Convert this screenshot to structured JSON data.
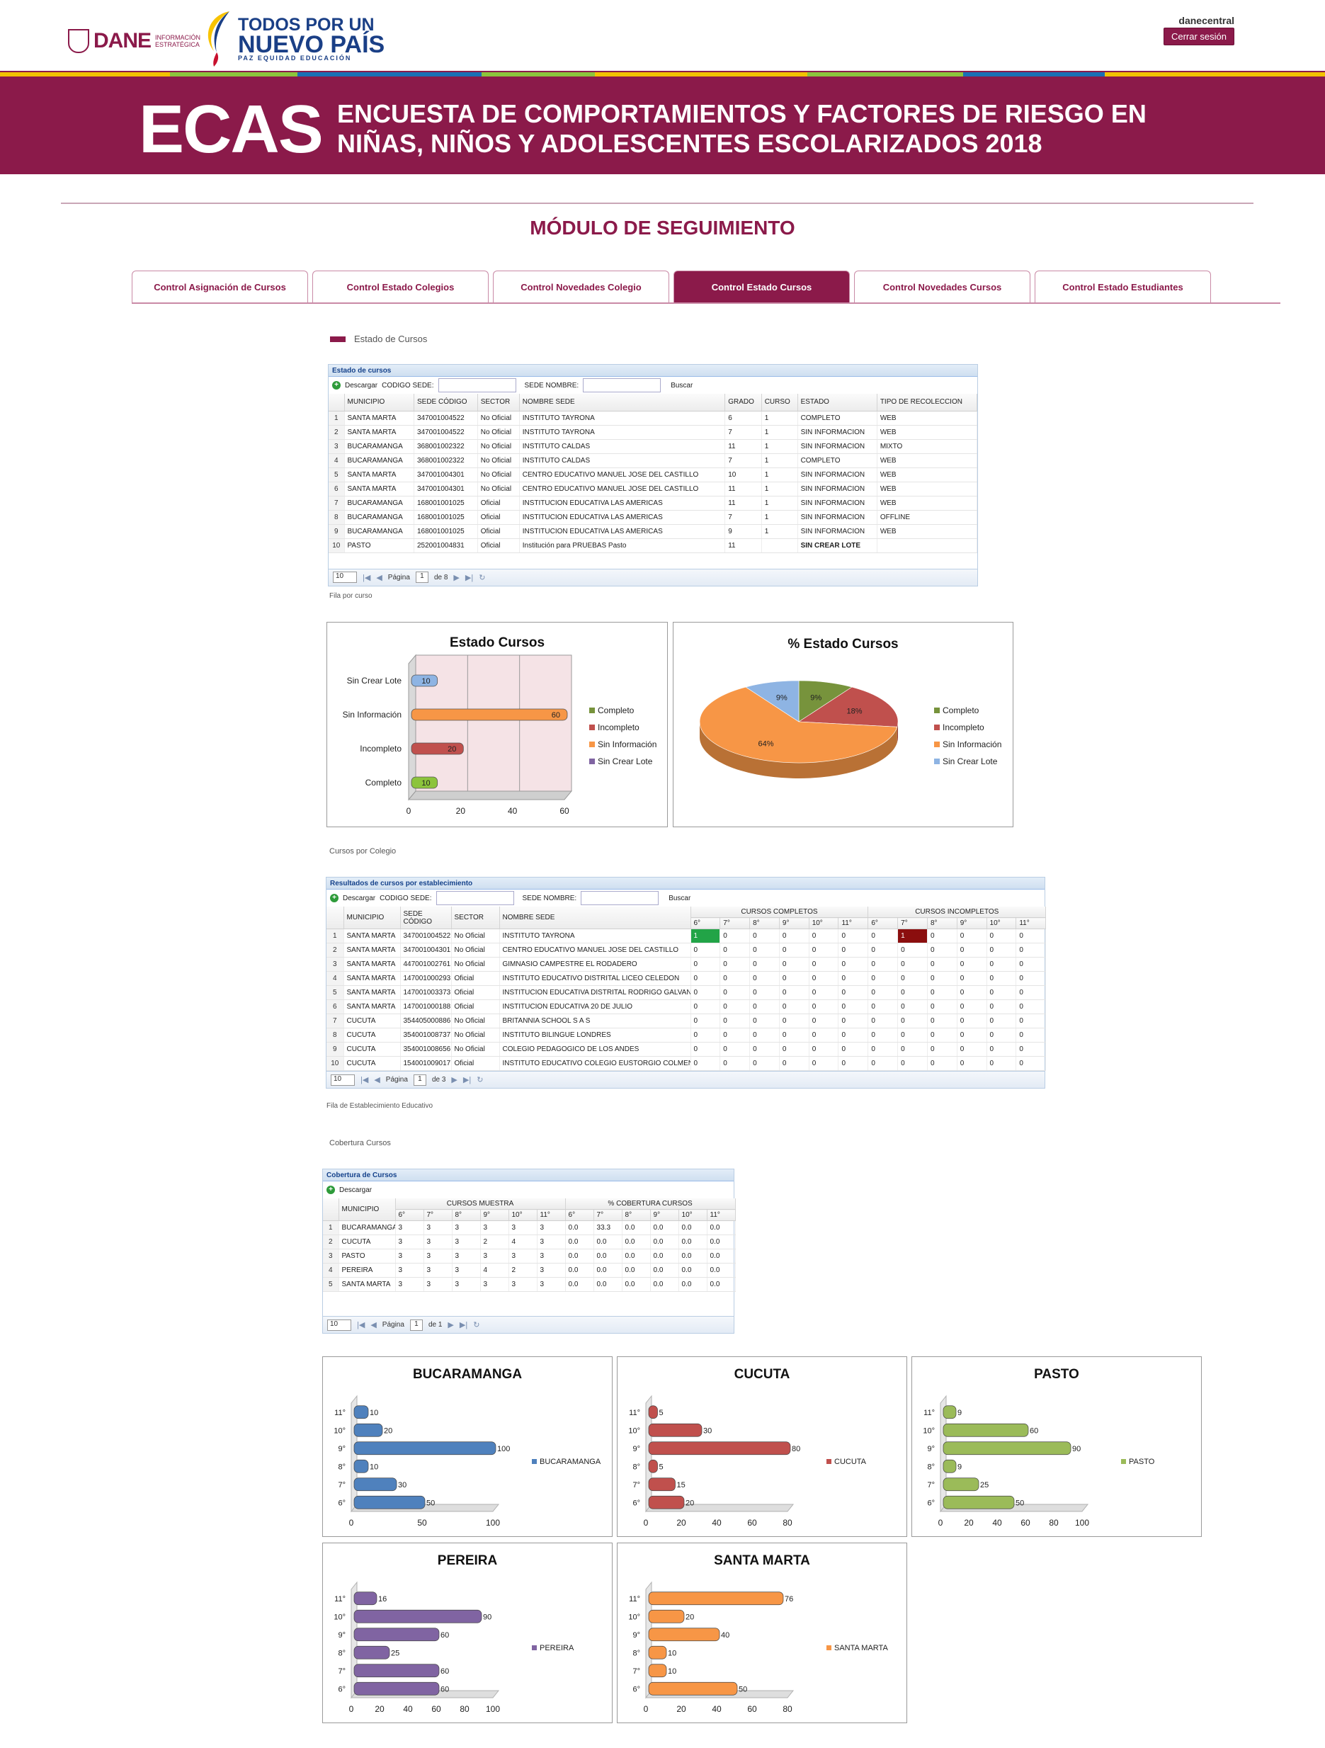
{
  "header": {
    "dane_logo": "DANE",
    "dane_subtitle": "INFORMACIÓN ESTRATÉGICA",
    "gov_logo_line1": "TODOS POR UN",
    "gov_logo_line2": "NUEVO PAÍS",
    "gov_logo_line3": "PAZ  EQUIDAD  EDUCACIÓN",
    "user": "danecentral",
    "logout_label": "Cerrar sesión"
  },
  "banner": {
    "acronym": "ECAS",
    "line1": "ENCUESTA DE COMPORTAMIENTOS Y FACTORES DE RIESGO EN",
    "line2": "NIÑAS, NIÑOS Y ADOLESCENTES ESCOLARIZADOS 2018",
    "color": "#8b1a4a"
  },
  "module_title": "MÓDULO DE SEGUIMIENTO",
  "tabs": [
    {
      "label": "Control Asignación de Cursos"
    },
    {
      "label": "Control Estado Colegios"
    },
    {
      "label": "Control Novedades Colegio"
    },
    {
      "label": "Control Estado Cursos",
      "active": true
    },
    {
      "label": "Control Novedades Cursos"
    },
    {
      "label": "Control Estado Estudiantes"
    }
  ],
  "section_label": "Estado de Cursos",
  "estado_grid": {
    "title": "Estado de cursos",
    "download": "Descargar",
    "codigo_label": "CODIGO SEDE:",
    "nombre_label": "SEDE NOMBRE:",
    "search": "Buscar",
    "columns": [
      "MUNICIPIO",
      "SEDE CÓDIGO",
      "SECTOR",
      "NOMBRE SEDE",
      "GRADO",
      "CURSO",
      "ESTADO",
      "TIPO DE RECOLECCION"
    ],
    "rows": [
      [
        "1",
        "SANTA MARTA",
        "347001004522",
        "No Oficial",
        "INSTITUTO TAYRONA",
        "6",
        "1",
        "COMPLETO",
        "WEB"
      ],
      [
        "2",
        "SANTA MARTA",
        "347001004522",
        "No Oficial",
        "INSTITUTO TAYRONA",
        "7",
        "1",
        "SIN INFORMACION",
        "WEB"
      ],
      [
        "3",
        "BUCARAMANGA",
        "368001002322",
        "No Oficial",
        "INSTITUTO CALDAS",
        "11",
        "1",
        "SIN INFORMACION",
        "MIXTO"
      ],
      [
        "4",
        "BUCARAMANGA",
        "368001002322",
        "No Oficial",
        "INSTITUTO CALDAS",
        "7",
        "1",
        "COMPLETO",
        "WEB"
      ],
      [
        "5",
        "SANTA MARTA",
        "347001004301",
        "No Oficial",
        "CENTRO EDUCATIVO MANUEL JOSE DEL CASTILLO",
        "10",
        "1",
        "SIN INFORMACION",
        "WEB"
      ],
      [
        "6",
        "SANTA MARTA",
        "347001004301",
        "No Oficial",
        "CENTRO EDUCATIVO MANUEL JOSE DEL CASTILLO",
        "11",
        "1",
        "SIN INFORMACION",
        "WEB"
      ],
      [
        "7",
        "BUCARAMANGA",
        "168001001025",
        "Oficial",
        "INSTITUCION EDUCATIVA LAS AMERICAS",
        "11",
        "1",
        "SIN INFORMACION",
        "WEB"
      ],
      [
        "8",
        "BUCARAMANGA",
        "168001001025",
        "Oficial",
        "INSTITUCION EDUCATIVA LAS AMERICAS",
        "7",
        "1",
        "SIN INFORMACION",
        "OFFLINE"
      ],
      [
        "9",
        "BUCARAMANGA",
        "168001001025",
        "Oficial",
        "INSTITUCION EDUCATIVA LAS AMERICAS",
        "9",
        "1",
        "SIN INFORMACION",
        "WEB"
      ],
      [
        "10",
        "PASTO",
        "252001004831",
        "Oficial",
        "Institución para PRUEBAS Pasto",
        "11",
        "",
        "SIN CREAR LOTE",
        ""
      ]
    ],
    "page_size": "10",
    "page_label": "Página",
    "page": "1",
    "page_of": "de 8",
    "footnote": "Fila por curso"
  },
  "estado_chart": {
    "chart_data": {
      "type": "bar",
      "title": "Estado Cursos",
      "categories": [
        "Completo",
        "Incompleto",
        "Sin Información",
        "Sin Crear Lote"
      ],
      "values": [
        10,
        20,
        60,
        10
      ],
      "colors": [
        "#8cc43c",
        "#c0504d",
        "#f79646",
        "#8eb4e3"
      ],
      "xlim": [
        0,
        60
      ],
      "ticks": [
        "0",
        "20",
        "40",
        "60"
      ],
      "legend": [
        "Completo",
        "Incompleto",
        "Sin Información",
        "Sin Crear Lote"
      ],
      "legend_colors": [
        "#77933c",
        "#c0504d",
        "#f79646",
        "#8064a2"
      ]
    }
  },
  "pie_chart": {
    "chart_data": {
      "type": "pie",
      "title": "% Estado Cursos",
      "labels": [
        "Completo",
        "Incompleto",
        "Sin Información",
        "Sin Crear Lote"
      ],
      "values": [
        9,
        18,
        64,
        9
      ],
      "value_labels": [
        "9%",
        "18%",
        "64%",
        "9%"
      ],
      "colors": [
        "#77933c",
        "#c0504d",
        "#f79646",
        "#8eb4e3"
      ]
    }
  },
  "colegio_label": "Cursos por Colegio",
  "colegio_grid": {
    "title": "Resultados de cursos por establecimiento",
    "download": "Descargar",
    "codigo_label": "CODIGO SEDE:",
    "nombre_label": "SEDE NOMBRE:",
    "search": "Buscar",
    "group_completos": "CURSOS COMPLETOS",
    "group_incompletos": "CURSOS INCOMPLETOS",
    "columns": [
      "MUNICIPIO",
      "SEDE CÓDIGO",
      "SECTOR",
      "NOMBRE SEDE"
    ],
    "grades": [
      "6°",
      "7°",
      "8°",
      "9°",
      "10°",
      "11°"
    ],
    "rows": [
      [
        "1",
        "SANTA MARTA",
        "347001004522",
        "No Oficial",
        "INSTITUTO TAYRONA",
        "1",
        "0",
        "0",
        "0",
        "0",
        "0",
        "0",
        "1",
        "0",
        "0",
        "0",
        "0"
      ],
      [
        "2",
        "SANTA MARTA",
        "347001004301",
        "No Oficial",
        "CENTRO EDUCATIVO MANUEL JOSE DEL CASTILLO",
        "0",
        "0",
        "0",
        "0",
        "0",
        "0",
        "0",
        "0",
        "0",
        "0",
        "0",
        "0"
      ],
      [
        "3",
        "SANTA MARTA",
        "447001002761",
        "No Oficial",
        "GIMNASIO CAMPESTRE EL RODADERO",
        "0",
        "0",
        "0",
        "0",
        "0",
        "0",
        "0",
        "0",
        "0",
        "0",
        "0",
        "0"
      ],
      [
        "4",
        "SANTA MARTA",
        "147001000293",
        "Oficial",
        "INSTITUTO EDUCATIVO DISTRITAL LICEO CELEDON",
        "0",
        "0",
        "0",
        "0",
        "0",
        "0",
        "0",
        "0",
        "0",
        "0",
        "0",
        "0"
      ],
      [
        "5",
        "SANTA MARTA",
        "147001003373",
        "Oficial",
        "INSTITUCION EDUCATIVA DISTRITAL RODRIGO GALVAN DE LA",
        "0",
        "0",
        "0",
        "0",
        "0",
        "0",
        "0",
        "0",
        "0",
        "0",
        "0",
        "0"
      ],
      [
        "6",
        "SANTA MARTA",
        "147001000188",
        "Oficial",
        "INSTITUCION EDUCATIVA 20 DE JULIO",
        "0",
        "0",
        "0",
        "0",
        "0",
        "0",
        "0",
        "0",
        "0",
        "0",
        "0",
        "0"
      ],
      [
        "7",
        "CUCUTA",
        "354405000886",
        "No Oficial",
        "BRITANNIA SCHOOL S A S",
        "0",
        "0",
        "0",
        "0",
        "0",
        "0",
        "0",
        "0",
        "0",
        "0",
        "0",
        "0"
      ],
      [
        "8",
        "CUCUTA",
        "354001008737",
        "No Oficial",
        "INSTITUTO BILINGUE LONDRES",
        "0",
        "0",
        "0",
        "0",
        "0",
        "0",
        "0",
        "0",
        "0",
        "0",
        "0",
        "0"
      ],
      [
        "9",
        "CUCUTA",
        "354001008656",
        "No Oficial",
        "COLEGIO PEDAGOGICO DE LOS ANDES",
        "0",
        "0",
        "0",
        "0",
        "0",
        "0",
        "0",
        "0",
        "0",
        "0",
        "0",
        "0"
      ],
      [
        "10",
        "CUCUTA",
        "154001009017",
        "Oficial",
        "INSTITUTO EDUCATIVO COLEGIO EUSTORGIO COLMENARES B",
        "0",
        "0",
        "0",
        "0",
        "0",
        "0",
        "0",
        "0",
        "0",
        "0",
        "0",
        "0"
      ]
    ],
    "page_size": "10",
    "page_label": "Página",
    "page": "1",
    "page_of": "de 3",
    "footnote": "Fila de Establecimiento Educativo"
  },
  "cobertura_label": "Cobertura Cursos",
  "cobertura_grid": {
    "title": "Cobertura de Cursos",
    "download": "Descargar",
    "municipio": "MUNICIPIO",
    "group_muestra": "CURSOS MUESTRA",
    "group_cobertura": "% COBERTURA CURSOS",
    "grades": [
      "6°",
      "7°",
      "8°",
      "9°",
      "10°",
      "11°"
    ],
    "rows": [
      [
        "1",
        "BUCARAMANGA",
        "3",
        "3",
        "3",
        "3",
        "3",
        "3",
        "0.0",
        "33.3",
        "0.0",
        "0.0",
        "0.0",
        "0.0"
      ],
      [
        "2",
        "CUCUTA",
        "3",
        "3",
        "3",
        "2",
        "4",
        "3",
        "0.0",
        "0.0",
        "0.0",
        "0.0",
        "0.0",
        "0.0"
      ],
      [
        "3",
        "PASTO",
        "3",
        "3",
        "3",
        "3",
        "3",
        "3",
        "0.0",
        "0.0",
        "0.0",
        "0.0",
        "0.0",
        "0.0"
      ],
      [
        "4",
        "PEREIRA",
        "3",
        "3",
        "3",
        "4",
        "2",
        "3",
        "0.0",
        "0.0",
        "0.0",
        "0.0",
        "0.0",
        "0.0"
      ],
      [
        "5",
        "SANTA MARTA",
        "3",
        "3",
        "3",
        "3",
        "3",
        "3",
        "0.0",
        "0.0",
        "0.0",
        "0.0",
        "0.0",
        "0.0"
      ]
    ],
    "page_size": "10",
    "page_label": "Página",
    "page": "1",
    "page_of": "de 1"
  },
  "city_charts": {
    "chart_data": [
      {
        "type": "bar",
        "title": "BUCARAMANGA",
        "categories": [
          "6°",
          "7°",
          "8°",
          "9°",
          "10°",
          "11°"
        ],
        "values": [
          50,
          30,
          10,
          100,
          20,
          10
        ],
        "xlim": [
          0,
          100
        ],
        "ticks": [
          "0",
          "50",
          "100"
        ],
        "legend": "BUCARAMANGA",
        "color": "#4f81bd"
      },
      {
        "type": "bar",
        "title": "CUCUTA",
        "categories": [
          "6°",
          "7°",
          "8°",
          "9°",
          "10°",
          "11°"
        ],
        "values": [
          20,
          15,
          5,
          80,
          30,
          5
        ],
        "xlim": [
          0,
          80
        ],
        "ticks": [
          "0",
          "20",
          "40",
          "60",
          "80"
        ],
        "legend": "CUCUTA",
        "color": "#c0504d"
      },
      {
        "type": "bar",
        "title": "PASTO",
        "categories": [
          "6°",
          "7°",
          "8°",
          "9°",
          "10°",
          "11°"
        ],
        "values": [
          50,
          25,
          9,
          90,
          60,
          9
        ],
        "xlim": [
          0,
          100
        ],
        "ticks": [
          "0",
          "20",
          "40",
          "60",
          "80",
          "100"
        ],
        "legend": "PASTO",
        "color": "#9bbb59"
      },
      {
        "type": "bar",
        "title": "PEREIRA",
        "categories": [
          "6°",
          "7°",
          "8°",
          "9°",
          "10°",
          "11°"
        ],
        "values": [
          60,
          60,
          25,
          60,
          90,
          16
        ],
        "xlim": [
          0,
          100
        ],
        "ticks": [
          "0",
          "20",
          "40",
          "60",
          "80",
          "100"
        ],
        "legend": "PEREIRA",
        "color": "#8064a2"
      },
      {
        "type": "bar",
        "title": "SANTA MARTA",
        "categories": [
          "6°",
          "7°",
          "8°",
          "9°",
          "10°",
          "11°"
        ],
        "values": [
          50,
          10,
          10,
          40,
          20,
          76
        ],
        "xlim": [
          0,
          80
        ],
        "ticks": [
          "0",
          "20",
          "40",
          "60",
          "80"
        ],
        "legend": "SANTA MARTA",
        "color": "#f79646"
      }
    ]
  }
}
